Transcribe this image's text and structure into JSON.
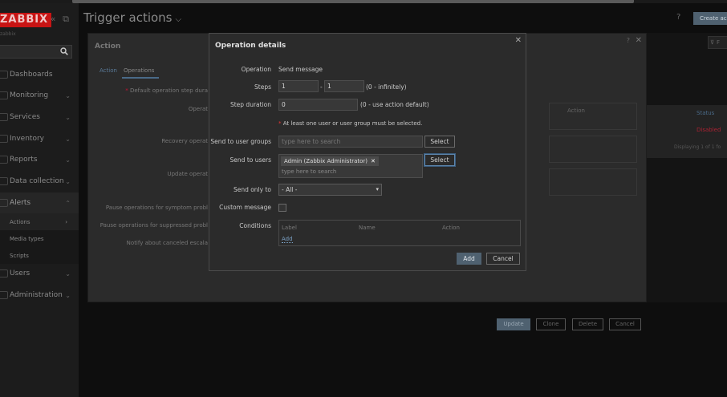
{
  "app": {
    "logo": "ZABBIX",
    "logo_sub": "zabbix"
  },
  "sidebar": {
    "items": [
      {
        "label": "Dashboards"
      },
      {
        "label": "Monitoring"
      },
      {
        "label": "Services"
      },
      {
        "label": "Inventory"
      },
      {
        "label": "Reports"
      },
      {
        "label": "Data collection"
      },
      {
        "label": "Alerts"
      },
      {
        "label": "Users"
      },
      {
        "label": "Administration"
      }
    ],
    "alerts_sub": [
      {
        "label": "Actions"
      },
      {
        "label": "Media types"
      },
      {
        "label": "Scripts"
      }
    ]
  },
  "header": {
    "title": "Trigger actions",
    "help": "?",
    "create_label": "Create ac"
  },
  "action_dialog": {
    "title": "Action",
    "tabs": [
      "Action",
      "Operations"
    ],
    "labels": {
      "default_step": "Default operation step dura",
      "operations": "Operat",
      "recovery": "Recovery operat",
      "update": "Update operat",
      "pause_symptom": "Pause operations for symptom probl",
      "pause_suppressed": "Pause operations for suppressed probl",
      "notify_canceled": "Notify about canceled escala"
    },
    "ops_header": "Action",
    "buttons": {
      "update": "Update",
      "clone": "Clone",
      "delete": "Delete",
      "cancel": "Cancel"
    }
  },
  "right_panel": {
    "filter": "F",
    "status_header": "Status",
    "status_value": "Disabled",
    "displaying": "Displaying 1 of 1 fo"
  },
  "modal": {
    "title": "Operation details",
    "operation_label": "Operation",
    "operation_value": "Send message",
    "steps_label": "Steps",
    "steps_from": "1",
    "steps_sep": "-",
    "steps_to": "1",
    "steps_hint": "(0 - infinitely)",
    "duration_label": "Step duration",
    "duration_value": "0",
    "duration_hint": "(0 - use action default)",
    "required_note": "At least one user or user group must be selected.",
    "user_groups_label": "Send to user groups",
    "user_groups_placeholder": "type here to search",
    "select_label": "Select",
    "users_label": "Send to users",
    "user_chip": "Admin (Zabbix Administrator)",
    "users_placeholder": "type here to search",
    "send_only_label": "Send only to",
    "send_only_value": "- All -",
    "custom_message_label": "Custom message",
    "conditions_label": "Conditions",
    "conditions_headers": [
      "Label",
      "Name",
      "Action"
    ],
    "conditions_add": "Add",
    "add_button": "Add",
    "cancel_button": "Cancel"
  }
}
